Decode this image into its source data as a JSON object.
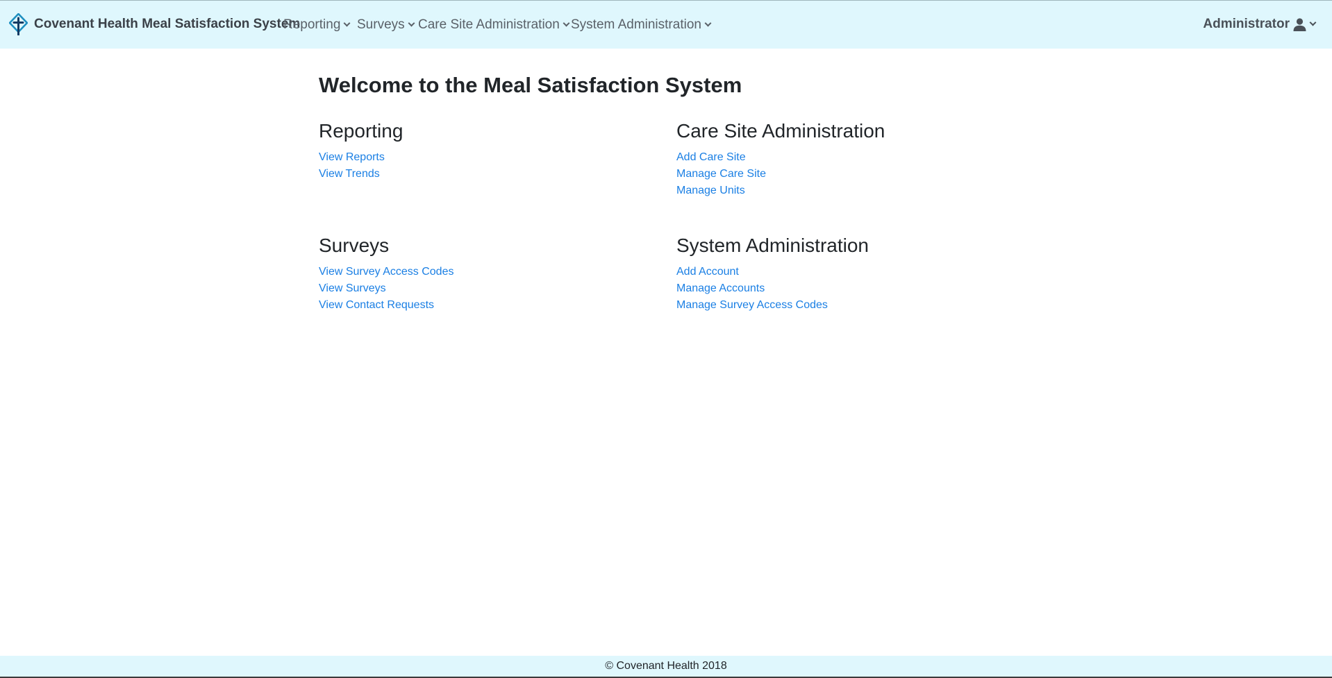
{
  "header": {
    "brand_name": "Covenant Health Meal Satisfaction System",
    "brand_color": "#1c5a7a",
    "nav": {
      "reporting": "Reporting",
      "surveys": "Surveys",
      "care_site_admin": "Care Site Administration",
      "system_admin": "System Administration"
    },
    "user_menu": {
      "label": "Administrator",
      "icon": "user-icon"
    },
    "background_color": "#dff7fd"
  },
  "main": {
    "title": "Welcome to the Meal Satisfaction System",
    "link_color": "#1a7fe4",
    "sections": {
      "reporting": {
        "heading": "Reporting",
        "links": [
          "View Reports",
          "View Trends"
        ]
      },
      "care_site_admin": {
        "heading": "Care Site Administration",
        "links": [
          "Add Care Site",
          "Manage Care Site",
          "Manage Units"
        ]
      },
      "surveys": {
        "heading": "Surveys",
        "links": [
          "View Survey Access Codes",
          "View Surveys",
          "View Contact Requests"
        ]
      },
      "system_admin": {
        "heading": "System Administration",
        "links": [
          "Add Account",
          "Manage Accounts",
          "Manage Survey Access Codes"
        ]
      }
    }
  },
  "footer": {
    "text": "© Covenant Health 2018"
  }
}
